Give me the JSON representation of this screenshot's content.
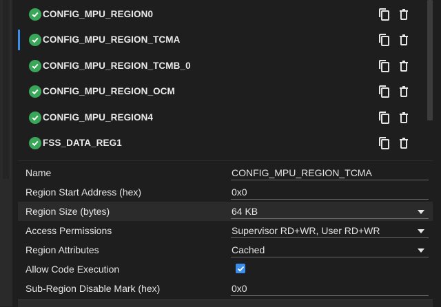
{
  "regions": [
    {
      "name": "CONFIG_MPU_REGION0"
    },
    {
      "name": "CONFIG_MPU_REGION_TCMA",
      "selected": true
    },
    {
      "name": "CONFIG_MPU_REGION_TCMB_0"
    },
    {
      "name": "CONFIG_MPU_REGION_OCM"
    },
    {
      "name": "CONFIG_MPU_REGION4"
    },
    {
      "name": "FSS_DATA_REG1"
    }
  ],
  "properties": {
    "name": {
      "label": "Name",
      "value": "CONFIG_MPU_REGION_TCMA"
    },
    "start_address": {
      "label": "Region Start Address (hex)",
      "value": "0x0"
    },
    "size": {
      "label": "Region Size (bytes)",
      "value": "64 KB"
    },
    "access": {
      "label": "Access Permissions",
      "value": "Supervisor RD+WR, User RD+WR"
    },
    "attributes": {
      "label": "Region Attributes",
      "value": "Cached"
    },
    "code_exec": {
      "label": "Allow Code Execution",
      "checked": true
    },
    "subregion": {
      "label": "Sub-Region Disable Mark (hex)",
      "value": "0x0"
    }
  },
  "colors": {
    "accent": "#3b8eea",
    "check_green": "#3aa65a"
  },
  "icons": {
    "status": "check-circle-icon",
    "copy": "copy-icon",
    "delete": "trash-icon"
  }
}
